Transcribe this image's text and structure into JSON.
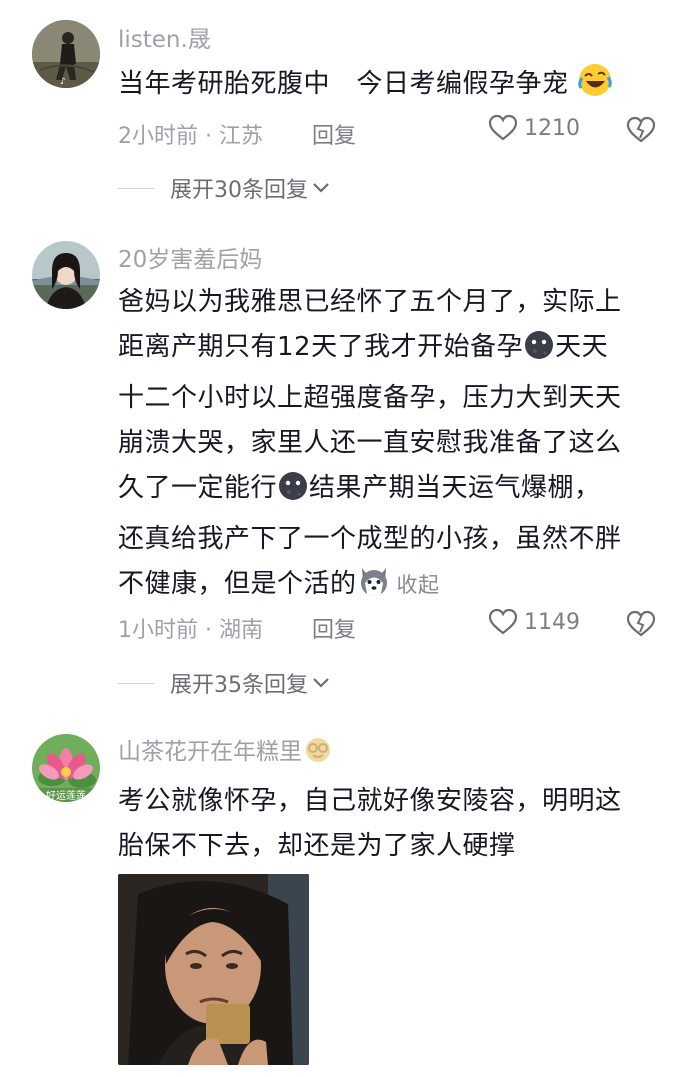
{
  "comments": [
    {
      "username": "listen.晟",
      "text": "当年考研胎死腹中　今日考编假孕争宠",
      "time": "2小时前 · 江苏",
      "reply": "回复",
      "likes": "1210",
      "expand": "展开30条回复"
    },
    {
      "username": "20岁害羞后妈",
      "lines": [
        "爸妈以为我雅思已经怀了五个月了，实际上",
        "距离产期只有12天了我才开始备孕",
        "天天",
        "十二个小时以上超强度备孕，压力大到天天",
        "崩溃大哭，家里人还一直安慰我准备了这么",
        "久了一定能行",
        "结果产期当天运气爆棚，",
        "还真给我产下了一个成型的小孩，虽然不胖",
        "不健康，但是个活的"
      ],
      "collapse": "收起",
      "time": "1小时前 · 湖南",
      "reply": "回复",
      "likes": "1149",
      "expand": "展开35条回复"
    },
    {
      "username": "山茶花开在年糕里",
      "avatar_text": "好运莲莲",
      "lines": [
        "考公就像怀孕，自己就好像安陵容，明明这",
        "胎保不下去，却还是为了家人硬撑"
      ]
    }
  ],
  "colors": {
    "text": "#161823",
    "muted": "#a0a1a8",
    "accent_lotus": "#e85a8c"
  }
}
